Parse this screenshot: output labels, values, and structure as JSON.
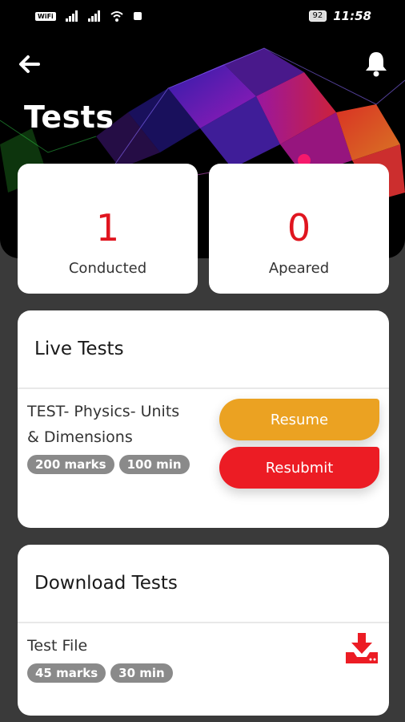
{
  "status_bar": {
    "wifi_badge": "WiFi",
    "battery": "92",
    "time": "11:58"
  },
  "header": {
    "title": "Tests",
    "back_icon": "arrow-left-icon",
    "notification_icon": "bell-icon"
  },
  "stats": [
    {
      "value": "1",
      "label": "Conducted"
    },
    {
      "value": "0",
      "label": "Apeared"
    }
  ],
  "live_tests": {
    "title": "Live Tests",
    "items": [
      {
        "name_line1": "TEST- Physics- Units",
        "name_line2": "& Dimensions",
        "marks": "200 marks",
        "duration": "100 min",
        "resume_label": "Resume",
        "resubmit_label": "Resubmit"
      }
    ]
  },
  "download_tests": {
    "title": "Download Tests",
    "items": [
      {
        "name": "Test File",
        "marks": "45 marks",
        "duration": "30 min",
        "icon": "download-icon"
      }
    ]
  },
  "colors": {
    "accent_red": "#e0151f",
    "resume_orange": "#eba222",
    "resubmit_red": "#ec1c24",
    "chip_gray": "#8a8a8a",
    "background": "#3a3a3a"
  }
}
